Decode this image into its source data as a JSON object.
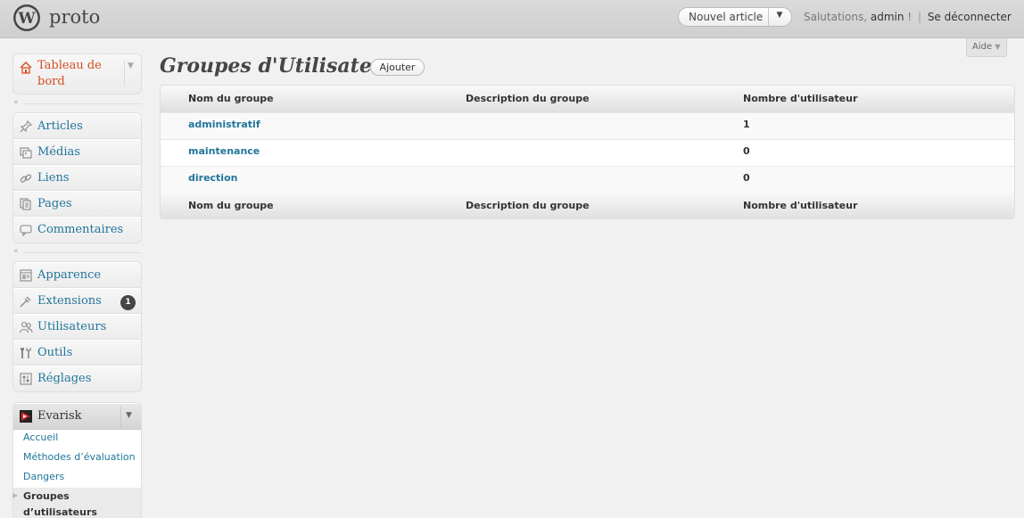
{
  "header": {
    "site_title": "proto",
    "new_post_label": "Nouvel article",
    "greeting_prefix": "Salutations,",
    "user": "admin",
    "greeting_suffix": "!",
    "logout": "Se déconnecter",
    "help": "Aide"
  },
  "sidebar": {
    "dashboard": "Tableau de bord",
    "group1": [
      {
        "label": "Articles",
        "icon": "pushpin-icon"
      },
      {
        "label": "Médias",
        "icon": "media-icon"
      },
      {
        "label": "Liens",
        "icon": "link-icon"
      },
      {
        "label": "Pages",
        "icon": "pages-icon"
      },
      {
        "label": "Commentaires",
        "icon": "comment-icon"
      }
    ],
    "group2": [
      {
        "label": "Apparence",
        "icon": "appearance-icon"
      },
      {
        "label": "Extensions",
        "icon": "plugin-icon",
        "badge": "1"
      },
      {
        "label": "Utilisateurs",
        "icon": "users-icon"
      },
      {
        "label": "Outils",
        "icon": "tools-icon"
      },
      {
        "label": "Réglages",
        "icon": "settings-icon"
      }
    ],
    "evarisk": {
      "label": "Evarisk",
      "items": [
        "Accueil",
        "Méthodes d’évaluation",
        "Dangers",
        "Groupes d’utilisateurs"
      ]
    }
  },
  "main": {
    "title": "Groupes d'Utilisateur",
    "add_button": "Ajouter",
    "columns": [
      "Nom du groupe",
      "Description du groupe",
      "Nombre d'utilisateur"
    ],
    "rows": [
      {
        "name": "administratif",
        "description": "",
        "count": "1"
      },
      {
        "name": "maintenance",
        "description": "",
        "count": "0"
      },
      {
        "name": "direction",
        "description": "",
        "count": "0"
      }
    ]
  },
  "colors": {
    "link": "#21759b",
    "current": "#d54e21",
    "header_bg": "#d4d4d4"
  }
}
